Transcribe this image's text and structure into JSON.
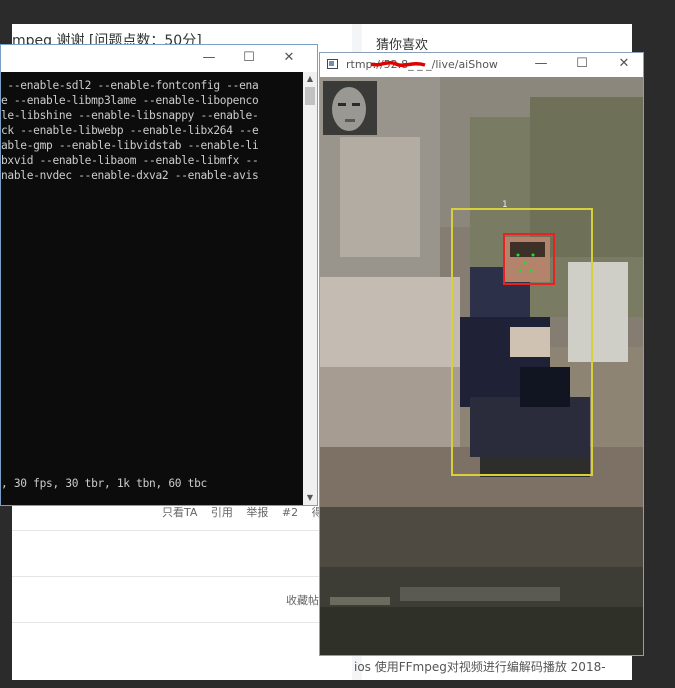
{
  "forum": {
    "title": "mpeg 谢谢 [问题点数：50分]",
    "side_title": "猜你喜欢",
    "post_actions": [
      "只看TA",
      "引用",
      "举报",
      "#2",
      "得"
    ],
    "collect_label": "收藏帖",
    "side_bottom": "ios 使用FFmpeg对视频进行编解码播放 2018-"
  },
  "console": {
    "lines": [
      " --enable-sdl2 --enable-fontconfig --ena",
      "e --enable-libmp3lame --enable-libopenco",
      "le-libshine --enable-libsnappy --enable-",
      "ck --enable-libwebp --enable-libx264 --e",
      "able-gmp --enable-libvidstab --enable-li",
      "bxvid --enable-libaom --enable-libmfx --",
      "nable-nvdec --enable-dxva2 --enable-avis"
    ],
    "status_line": ", 30 fps, 30 tbr, 1k tbn, 60 tbc",
    "controls": [
      "—",
      "☐",
      "✕"
    ]
  },
  "video_window": {
    "title": "rtmp://52.8_ _ _/live/aiShow",
    "controls": [
      "—",
      "☐",
      "✕"
    ],
    "detection_label": "1"
  },
  "colors": {
    "face_box": "#e8231f",
    "person_box": "#d8d03a",
    "console_bg": "#0c0c0c",
    "console_text": "#cccccc",
    "redaction": "#e00000"
  }
}
